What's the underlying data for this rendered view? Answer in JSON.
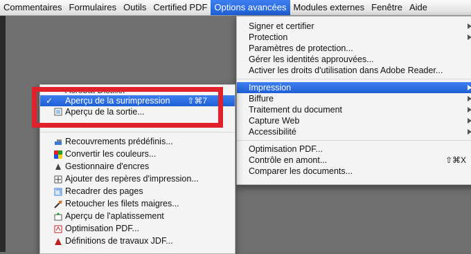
{
  "menubar": {
    "items": [
      "Commentaires",
      "Formulaires",
      "Outils",
      "Certified PDF",
      "Options avancées",
      "Modules externes",
      "Fenêtre",
      "Aide"
    ],
    "active_index": 4
  },
  "main_menu": {
    "group1": [
      "Signer et certifier",
      "Protection",
      "Paramètres de protection...",
      "Gérer les identités approuvées...",
      "Activer les droits d'utilisation dans Adobe Reader..."
    ],
    "group2": [
      "Impression",
      "Biffure",
      "Traitement du document",
      "Capture Web",
      "Accessibilité"
    ],
    "group3": [
      "Optimisation PDF...",
      "Contrôle en amont...",
      "Comparer les documents..."
    ],
    "preflight_shortcut": "⇧⌘X"
  },
  "sub_menu": {
    "partial_top": "Acrobat Distiller",
    "overprint": "Aperçu de la surimpression",
    "overprint_shortcut": "⇧⌘7",
    "output": "Aperçu de la sortie...",
    "items": [
      {
        "label": "Recouvrements prédéfinis...",
        "icon": "trap-presets-icon"
      },
      {
        "label": "Convertir les couleurs...",
        "icon": "convert-colors-icon"
      },
      {
        "label": "Gestionnaire d'encres",
        "icon": "ink-manager-icon"
      },
      {
        "label": "Ajouter des repères d'impression...",
        "icon": "printer-marks-icon"
      },
      {
        "label": "Recadrer des pages",
        "icon": "crop-pages-icon"
      },
      {
        "label": "Retoucher les filets maigres...",
        "icon": "fix-hairlines-icon"
      },
      {
        "label": "Aperçu de l'aplatissement",
        "icon": "flattener-preview-icon"
      },
      {
        "label": "Optimisation PDF...",
        "icon": "pdf-optimizer-icon"
      },
      {
        "label": "Définitions de travaux JDF...",
        "icon": "jdf-definitions-icon"
      }
    ]
  },
  "colors": {
    "highlight": "#2a6de6",
    "annotation_red": "#e0202a"
  }
}
